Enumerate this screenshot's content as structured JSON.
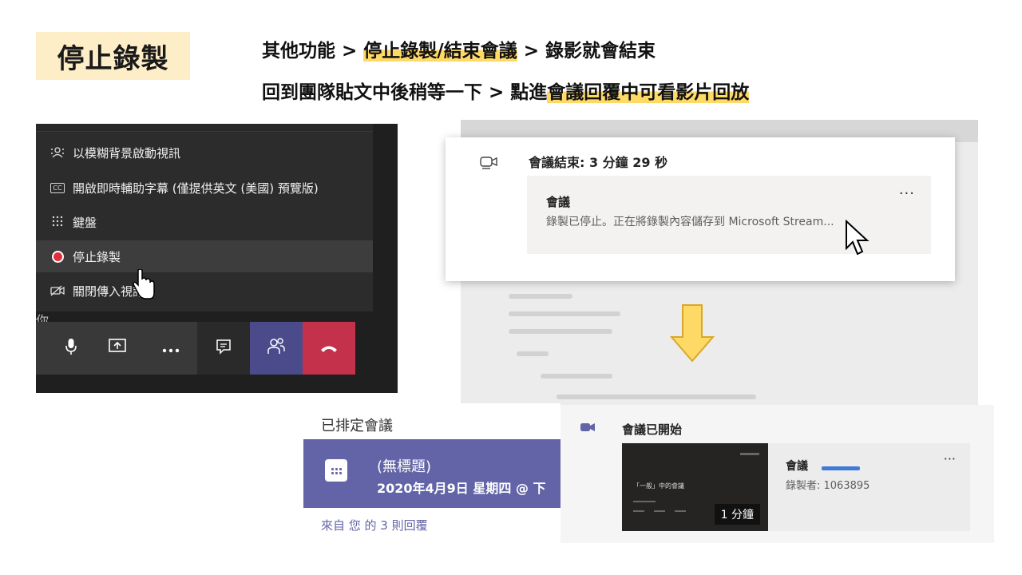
{
  "title": "停止錄製",
  "steps": {
    "line1_pre": "其他功能 > ",
    "line1_hl": "停止錄製/結束會議",
    "line1_post": " > 錄影就會結束",
    "line2_pre": "回到團隊貼文中後稍等一下 > 點進",
    "line2_hl": "會議回覆中可看影片回放"
  },
  "menu": {
    "items": [
      {
        "icon": "blur-background-icon",
        "label": "以模糊背景啟動視訊"
      },
      {
        "icon": "cc-icon",
        "label": "開啟即時輔助字幕 (僅提供英文 (美國) 預覽版)"
      },
      {
        "icon": "keypad-icon",
        "label": "鍵盤"
      },
      {
        "icon": "record-icon",
        "label": "停止錄製"
      },
      {
        "icon": "video-off-icon",
        "label": "關閉傳入視訊"
      }
    ],
    "side_char": "你"
  },
  "ended": {
    "title": "會議結束: 3 分鐘 29 秒",
    "name": "會議",
    "status": "錄製已停止。正在將錄製內容儲存到 Microsoft Stream...",
    "more": "···"
  },
  "scheduled": {
    "label": "已排定會議",
    "name": "(無標題)",
    "date": "2020年4月9日 星期四 @ 下",
    "reply": "來自 您 的 3 則回覆"
  },
  "started": {
    "title": "會議已開始",
    "thumb_title": "「一般」中的會議",
    "duration": "1 分鐘",
    "name": "會議",
    "recorded_by": "錄製者: 1063895",
    "more": "···"
  },
  "colors": {
    "title_bg": "#fdeec8",
    "highlight": "#ffd966",
    "teams_purple": "#6264a7",
    "hangup_red": "#c4314b",
    "arrow_yellow": "#ffd966"
  }
}
